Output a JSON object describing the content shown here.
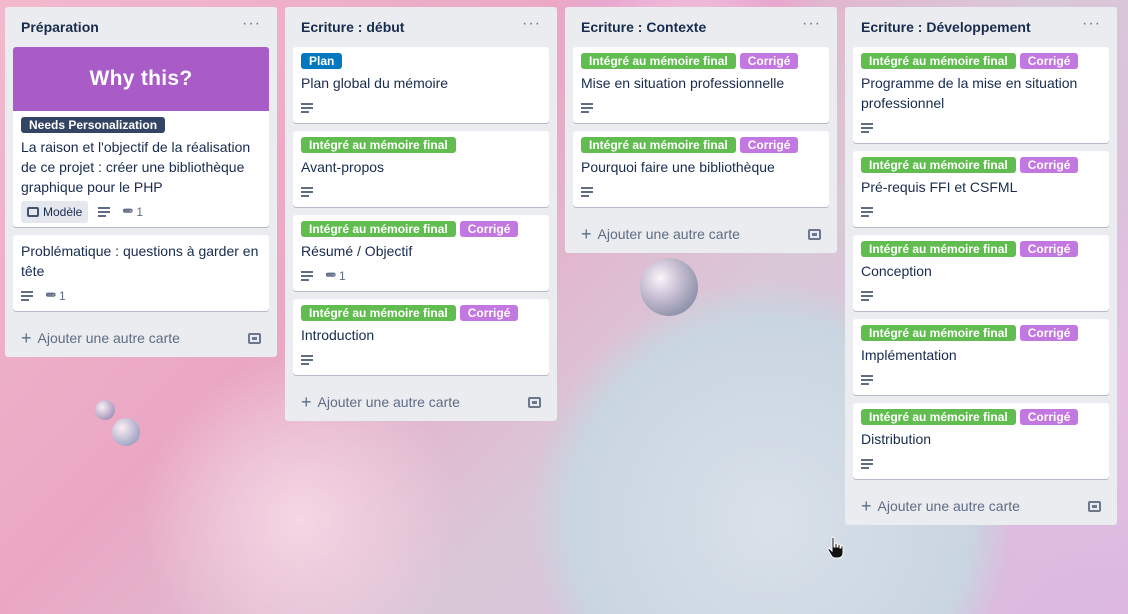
{
  "colors": {
    "list_bg": "#ebecf0",
    "label_green": "#61bd4f",
    "label_purple": "#c377e0",
    "label_blue": "#0079bf",
    "label_dark": "#344563",
    "cover_purple": "#a95bc8"
  },
  "lists": [
    {
      "title": "Préparation",
      "menu": "···",
      "cards": [
        {
          "cover_text": "Why this?",
          "labels": [
            {
              "text": "Needs Personalization",
              "color": "#344563"
            }
          ],
          "title": "La raison et l'objectif de la réalisation de ce projet : créer une bibliothèque graphique pour le PHP",
          "template_badge": "Modèle",
          "description": true,
          "attachments": "1"
        },
        {
          "labels": [],
          "title": "Problématique : questions à garder en tête",
          "description": true,
          "attachments": "1"
        }
      ],
      "add_card": "Ajouter une autre carte"
    },
    {
      "title": "Ecriture : début",
      "menu": "···",
      "cards": [
        {
          "labels": [
            {
              "text": "Plan",
              "color": "#0079bf"
            }
          ],
          "title": "Plan global du mémoire",
          "description": true
        },
        {
          "labels": [
            {
              "text": "Intégré au mémoire final",
              "color": "#61bd4f"
            }
          ],
          "title": "Avant-propos",
          "description": true
        },
        {
          "labels": [
            {
              "text": "Intégré au mémoire final",
              "color": "#61bd4f"
            },
            {
              "text": "Corrigé",
              "color": "#c377e0"
            }
          ],
          "title": "Résumé / Objectif",
          "description": true,
          "attachments": "1"
        },
        {
          "labels": [
            {
              "text": "Intégré au mémoire final",
              "color": "#61bd4f"
            },
            {
              "text": "Corrigé",
              "color": "#c377e0"
            }
          ],
          "title": "Introduction",
          "description": true
        }
      ],
      "add_card": "Ajouter une autre carte"
    },
    {
      "title": "Ecriture : Contexte",
      "menu": "···",
      "cards": [
        {
          "labels": [
            {
              "text": "Intégré au mémoire final",
              "color": "#61bd4f"
            },
            {
              "text": "Corrigé",
              "color": "#c377e0"
            }
          ],
          "title": "Mise en situation professionnelle",
          "description": true
        },
        {
          "labels": [
            {
              "text": "Intégré au mémoire final",
              "color": "#61bd4f"
            },
            {
              "text": "Corrigé",
              "color": "#c377e0"
            }
          ],
          "title": "Pourquoi faire une bibliothèque",
          "description": true
        }
      ],
      "add_card": "Ajouter une autre carte"
    },
    {
      "title": "Ecriture : Développement",
      "menu": "···",
      "cards": [
        {
          "labels": [
            {
              "text": "Intégré au mémoire final",
              "color": "#61bd4f"
            },
            {
              "text": "Corrigé",
              "color": "#c377e0"
            }
          ],
          "title": "Programme de la mise en situation professionnel",
          "description": true
        },
        {
          "labels": [
            {
              "text": "Intégré au mémoire final",
              "color": "#61bd4f"
            },
            {
              "text": "Corrigé",
              "color": "#c377e0"
            }
          ],
          "title": "Pré-requis FFI et CSFML",
          "description": true
        },
        {
          "labels": [
            {
              "text": "Intégré au mémoire final",
              "color": "#61bd4f"
            },
            {
              "text": "Corrigé",
              "color": "#c377e0"
            }
          ],
          "title": "Conception",
          "description": true
        },
        {
          "labels": [
            {
              "text": "Intégré au mémoire final",
              "color": "#61bd4f"
            },
            {
              "text": "Corrigé",
              "color": "#c377e0"
            }
          ],
          "title": "Implémentation",
          "description": true
        },
        {
          "labels": [
            {
              "text": "Intégré au mémoire final",
              "color": "#61bd4f"
            },
            {
              "text": "Corrigé",
              "color": "#c377e0"
            }
          ],
          "title": "Distribution",
          "description": true
        }
      ],
      "add_card": "Ajouter une autre carte"
    }
  ]
}
